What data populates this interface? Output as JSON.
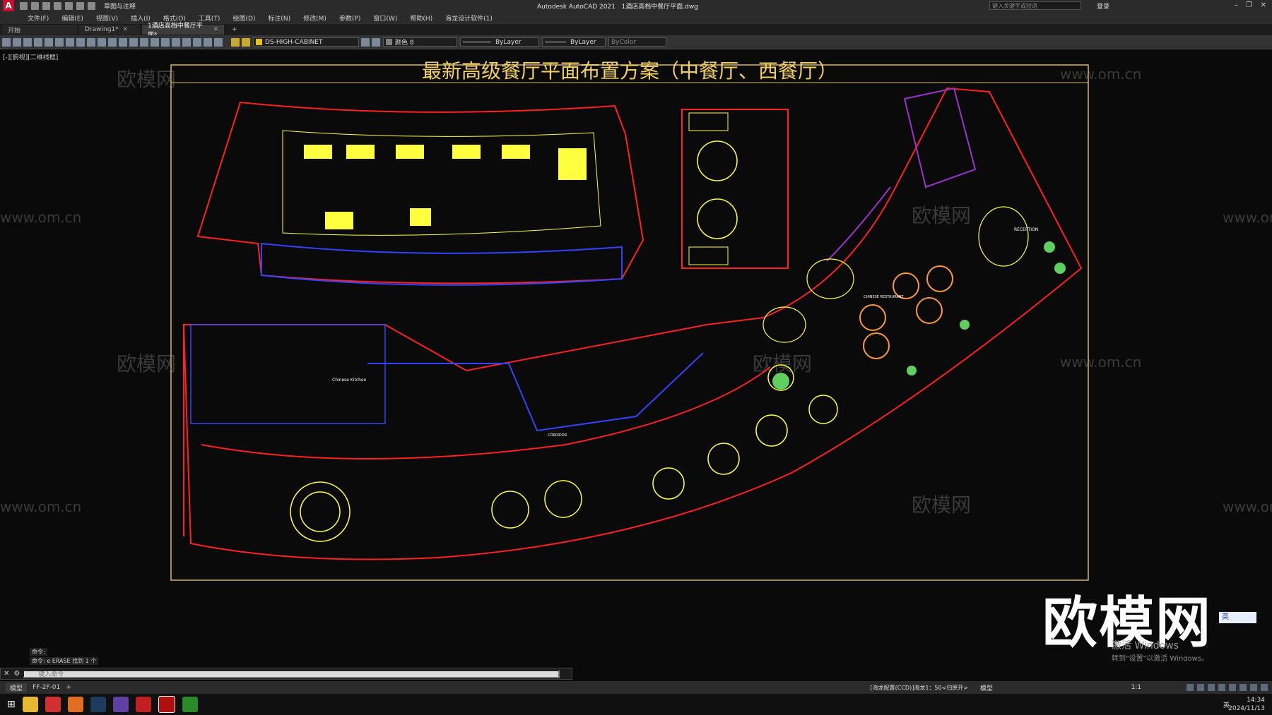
{
  "title_bar": {
    "workspace": "草图与注释",
    "app_title": "Autodesk AutoCAD 2021",
    "file_name": "1酒店高档中餐厅平面.dwg",
    "search_placeholder": "键入关键字或短语",
    "sign_in": "登录"
  },
  "menu": [
    "文件(F)",
    "编辑(E)",
    "视图(V)",
    "插入(I)",
    "格式(O)",
    "工具(T)",
    "绘图(D)",
    "标注(N)",
    "修改(M)",
    "参数(P)",
    "窗口(W)",
    "帮助(H)",
    "海龙设计软件(1)"
  ],
  "tabs": [
    {
      "label": "开始",
      "active": false,
      "closable": false
    },
    {
      "label": "Drawing1*",
      "active": false,
      "closable": true
    },
    {
      "label": "1酒店高档中餐厅平面*",
      "active": true,
      "closable": true
    }
  ],
  "toolbar": {
    "layer": "DS-HIGH-CABINET",
    "color": "颜色 8",
    "linetype": "ByLayer",
    "lineweight": "ByLayer",
    "plotstyle": "ByColor"
  },
  "viewport": {
    "label": "[-][俯视][二维线框]",
    "drawing_title": "最新高级餐厅平面布置方案（中餐厅、西餐厅）",
    "watermark": "欧模网",
    "watermark_url": "www.om.cn",
    "room_labels": [
      "RECEPTION",
      "CHINESE RESTAURANT",
      "Chinese Kitchen",
      "CORRIDOR"
    ]
  },
  "command": {
    "history": [
      "命令:",
      "命令: e ERASE 找到 1 个"
    ],
    "placeholder": "键入命令"
  },
  "layout_tabs": [
    "模型",
    "FF-2F-01"
  ],
  "status": {
    "coords": "[海龙配置(CCD)]海龙1：50<归原开>",
    "mode": "模型",
    "scale": "1:1"
  },
  "overlay": {
    "brand": "欧模网",
    "ime": "英",
    "activate_title": "激活 Windows",
    "activate_sub": "转到\"设置\"以激活 Windows。"
  },
  "taskbar": {
    "time": "14:34",
    "date": "2024/11/13",
    "ime_lang": "英"
  },
  "colors": {
    "frame": "#d4b86a",
    "wall": "#ff2020",
    "furniture": "#ffff40",
    "partition": "#3344ff",
    "plant": "#5fcf5f",
    "accent_orange": "#ff9933",
    "purple": "#9933cc"
  }
}
